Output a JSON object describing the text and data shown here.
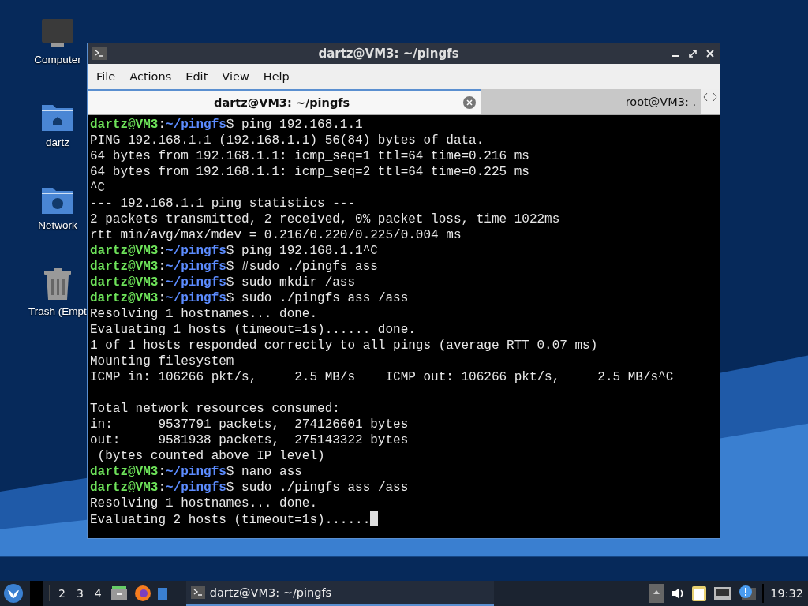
{
  "desktop_icons": [
    {
      "kind": "computer",
      "label": "Computer"
    },
    {
      "kind": "home",
      "label": "dartz"
    },
    {
      "kind": "network",
      "label": "Network"
    },
    {
      "kind": "trash",
      "label": "Trash (Empt"
    }
  ],
  "window": {
    "title": "dartz@VM3: ~/pingfs"
  },
  "menu": [
    "File",
    "Actions",
    "Edit",
    "View",
    "Help"
  ],
  "tabs": [
    {
      "label": "dartz@VM3: ~/pingfs",
      "selected": true
    },
    {
      "label": "root@VM3: .",
      "selected": false
    }
  ],
  "terminal": {
    "cursor": true,
    "lines": [
      {
        "kind": "prompt",
        "user": "dartz@VM3",
        "sep": ":",
        "path": "~/pingfs",
        "sigil": "$",
        "command": "ping 192.168.1.1"
      },
      {
        "kind": "output",
        "text": "PING 192.168.1.1 (192.168.1.1) 56(84) bytes of data."
      },
      {
        "kind": "output",
        "text": "64 bytes from 192.168.1.1: icmp_seq=1 ttl=64 time=0.216 ms"
      },
      {
        "kind": "output",
        "text": "64 bytes from 192.168.1.1: icmp_seq=2 ttl=64 time=0.225 ms"
      },
      {
        "kind": "output",
        "text": "^C"
      },
      {
        "kind": "output",
        "text": "--- 192.168.1.1 ping statistics ---"
      },
      {
        "kind": "output",
        "text": "2 packets transmitted, 2 received, 0% packet loss, time 1022ms"
      },
      {
        "kind": "output",
        "text": "rtt min/avg/max/mdev = 0.216/0.220/0.225/0.004 ms"
      },
      {
        "kind": "prompt",
        "user": "dartz@VM3",
        "sep": ":",
        "path": "~/pingfs",
        "sigil": "$",
        "command": "ping 192.168.1.1^C"
      },
      {
        "kind": "prompt",
        "user": "dartz@VM3",
        "sep": ":",
        "path": "~/pingfs",
        "sigil": "$",
        "command": "#sudo ./pingfs ass"
      },
      {
        "kind": "prompt",
        "user": "dartz@VM3",
        "sep": ":",
        "path": "~/pingfs",
        "sigil": "$",
        "command": "sudo mkdir /ass"
      },
      {
        "kind": "prompt",
        "user": "dartz@VM3",
        "sep": ":",
        "path": "~/pingfs",
        "sigil": "$",
        "command": "sudo ./pingfs ass /ass"
      },
      {
        "kind": "output",
        "text": "Resolving 1 hostnames... done."
      },
      {
        "kind": "output",
        "text": "Evaluating 1 hosts (timeout=1s)...... done."
      },
      {
        "kind": "output",
        "text": "1 of 1 hosts responded correctly to all pings (average RTT 0.07 ms)"
      },
      {
        "kind": "output",
        "text": "Mounting filesystem"
      },
      {
        "kind": "output",
        "text": "ICMP in: 106266 pkt/s,     2.5 MB/s    ICMP out: 106266 pkt/s,     2.5 MB/s^C"
      },
      {
        "kind": "blank"
      },
      {
        "kind": "output",
        "text": "Total network resources consumed:"
      },
      {
        "kind": "output",
        "text": "in:      9537791 packets,  274126601 bytes"
      },
      {
        "kind": "output",
        "text": "out:     9581938 packets,  275143322 bytes"
      },
      {
        "kind": "output",
        "text": " (bytes counted above IP level)"
      },
      {
        "kind": "prompt",
        "user": "dartz@VM3",
        "sep": ":",
        "path": "~/pingfs",
        "sigil": "$",
        "command": "nano ass"
      },
      {
        "kind": "prompt",
        "user": "dartz@VM3",
        "sep": ":",
        "path": "~/pingfs",
        "sigil": "$",
        "command": "sudo ./pingfs ass /ass"
      },
      {
        "kind": "output",
        "text": "Resolving 1 hostnames... done."
      },
      {
        "kind": "output",
        "text": "Evaluating 2 hosts (timeout=1s)......"
      }
    ]
  },
  "taskbar": {
    "workspaces": [
      {
        "label": "2",
        "selected": false
      },
      {
        "label": "3",
        "selected": false
      },
      {
        "label": "4",
        "selected": false
      }
    ],
    "task": {
      "label": "dartz@VM3: ~/pingfs",
      "selected": true
    },
    "clock": "19:32"
  }
}
